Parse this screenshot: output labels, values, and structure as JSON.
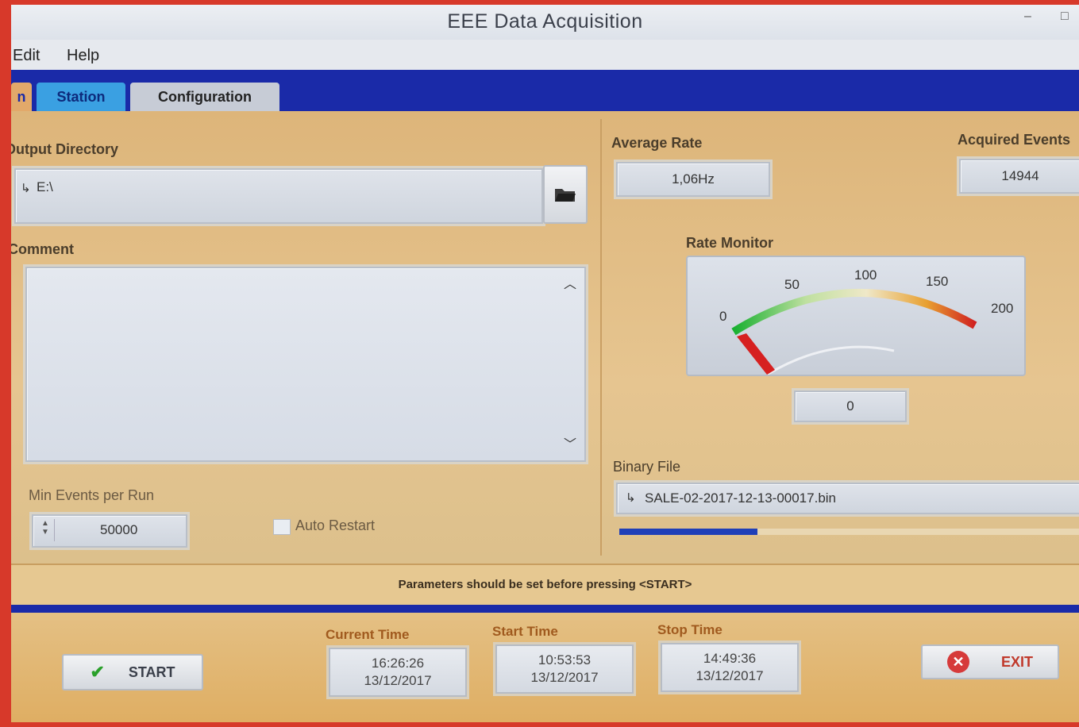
{
  "window": {
    "title": "EEE Data Acquisition",
    "minimize": "–",
    "maximize": "□"
  },
  "menu": {
    "edit": "Edit",
    "help": "Help"
  },
  "tabs": {
    "main": "n",
    "station": "Station",
    "configuration": "Configuration"
  },
  "left": {
    "output_directory_label": "Output Directory",
    "output_directory_value": "E:\\",
    "comment_label": "Comment",
    "comment_value": "",
    "min_events_label": "Min Events per Run",
    "min_events_value": "50000",
    "auto_restart_label": "Auto Restart",
    "auto_restart_checked": false
  },
  "right": {
    "average_rate_label": "Average Rate",
    "average_rate_value": "1,06Hz",
    "acquired_events_label": "Acquired Events",
    "acquired_events_value": "14944",
    "rate_monitor_label": "Rate Monitor",
    "gauge": {
      "min": 0,
      "max": 200,
      "ticks": [
        "0",
        "50",
        "100",
        "150",
        "200"
      ],
      "value": 0
    },
    "rate_display_value": "0",
    "binary_file_label": "Binary File",
    "binary_file_value": "SALE-02-2017-12-13-00017.bin",
    "progress_fraction": 0.3
  },
  "status_message": "Parameters should be set before pressing <START>",
  "bottom": {
    "start_label": "START",
    "exit_label": "EXIT",
    "current_time_label": "Current Time",
    "current_time": "16:26:26",
    "current_date": "13/12/2017",
    "start_time_label": "Start Time",
    "start_time": "10:53:53",
    "start_date": "13/12/2017",
    "stop_time_label": "Stop Time",
    "stop_time": "14:49:36",
    "stop_date": "13/12/2017"
  },
  "colors": {
    "tab_bar": "#1a2aa8",
    "panel": "#e1bf85",
    "exit_icon": "#d63a3a",
    "gauge_needle": "#d62020"
  }
}
